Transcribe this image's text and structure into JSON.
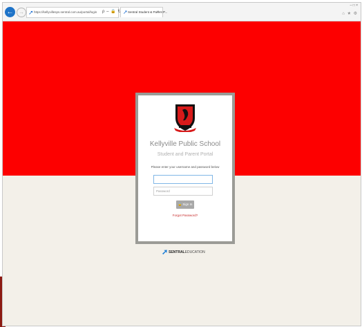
{
  "browser": {
    "url": "https://kellyvillesps.sentral.com.au/portal/login",
    "address_tools": "ρ – 🔒 ↻",
    "tab_title": "Sentral Student & Parent P...",
    "tab_close": "×",
    "window_controls": "– □ ×",
    "browser_icons": "⌂ ★ ⚙"
  },
  "login": {
    "school_name": "Kellyville Public School",
    "portal_name": "Student and Parent Portal",
    "instruction": "Please enter your username and password below",
    "username": {
      "value": "",
      "placeholder": ""
    },
    "password": {
      "value": "",
      "placeholder": "Password"
    },
    "signin_label": "🔒 Sign In",
    "forgot_label": "Forgot Password?"
  },
  "footer": {
    "brand_bold": "SENTRAL",
    "brand_rest": "EDUCATION"
  },
  "colors": {
    "banner": "#fd0000",
    "page_bg": "#f3f0e9",
    "accent_link": "#c62828",
    "brand_blue": "#1e7fd6"
  },
  "icons": [
    "back-arrow-icon",
    "forward-arrow-icon",
    "sentral-favicon-icon",
    "home-icon",
    "favorites-star-icon",
    "settings-gear-icon",
    "school-crest-icon",
    "sentral-logo-icon"
  ]
}
